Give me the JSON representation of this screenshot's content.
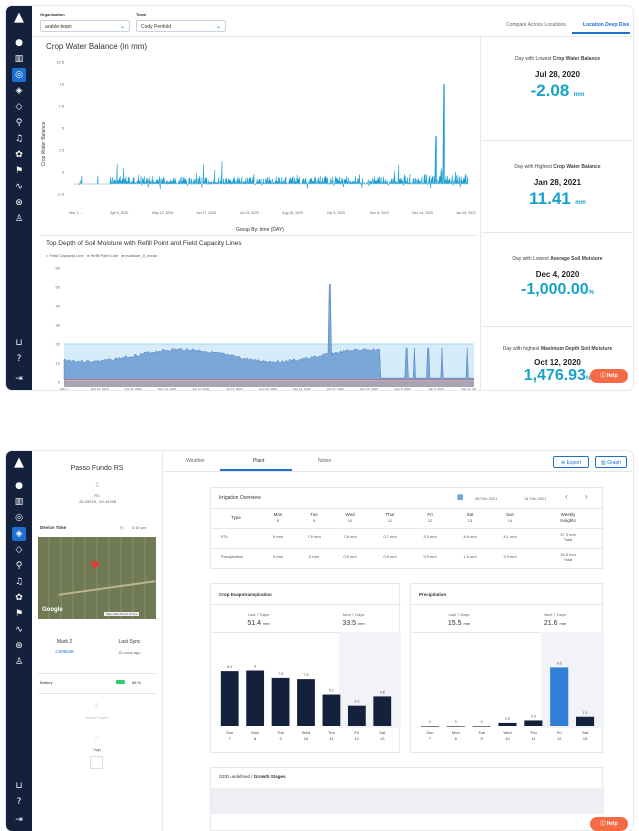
{
  "top": {
    "filters": {
      "organisation_label": "Organisation",
      "organisation_value": "arable-team",
      "team_label": "Team",
      "team_value": "Cody Penfold"
    },
    "tabs": [
      "Compare Across Locations",
      "Location Deep Dive"
    ],
    "chart1": {
      "title": "Crop Water Balance (in mm)",
      "ylabel": "Crop Water Balance",
      "xlabel": "Group By: time (DAY)",
      "ticks_y": [
        "12.5",
        "10",
        "7.5",
        "5",
        "2.5",
        "0",
        "-2.5"
      ],
      "ticks_x": [
        "Mar 1, ...",
        "Apr 6, 2020",
        "May 12, 2020",
        "Jun 17, 2020",
        "Jul 23, 2020",
        "Aug 28, 2020",
        "Oct 3, 2020",
        "Nov 8, 2020",
        "Dec 14, 2020",
        "Jan 19, 2021"
      ]
    },
    "chart2": {
      "title": "Top Depth of Soil Moisture with Refill Point and Field Capacity Lines",
      "legend": [
        "Field Capacity Line",
        "Refill Point Line",
        "moisture_0_mean"
      ],
      "legend_colors": [
        "#8fd3f0",
        "#e24a33",
        "#1f4e9c"
      ],
      "ticks_y": [
        "60",
        "50",
        "40",
        "30",
        "20",
        "10",
        "0"
      ],
      "ticks_x": [
        "Mar 1, ...",
        "Mar 19, 2020",
        "Apr 26, 2020",
        "May 14, 2020",
        "Jun 11, 2020",
        "Jul 13, 2020",
        "Aug 10, 2020",
        "Sep 12, 2020",
        "Oct 17, 2020",
        "Nov 13, 2020",
        "Dec 5, 2020",
        "Jan 5, 2021",
        "Feb 12, 2021"
      ]
    },
    "kpis": [
      {
        "title_pre": "Day with Lowest ",
        "title_bold": "Crop Water Balance",
        "date": "Jul 28, 2020",
        "value": "-2.08",
        "unit": "mm"
      },
      {
        "title_pre": "Day with Highest ",
        "title_bold": "Crop Water Balance",
        "date": "Jan 28, 2021",
        "value": "11.41",
        "unit": "mm"
      },
      {
        "title_pre": "Day with Lowest ",
        "title_bold": "Average Soil Moisture",
        "date": "Dec 4, 2020",
        "value": "-1,000.00",
        "unit": "%"
      },
      {
        "title_pre": "Day with highest ",
        "title_bold": "Maximum Depth Soil Moisture",
        "date": "Oct 12, 2020",
        "value": "1,476.93",
        "unit": "%"
      }
    ],
    "help": "Help"
  },
  "bottom": {
    "device": {
      "name": "Passo Fundo RS",
      "location_code": "RS",
      "coords": "-28.25978, -52.44298",
      "device_time_label": "Device Time",
      "device_time": "4:16 pm",
      "map_logo": "Google",
      "map_terms": "Map Data   Terms of Use",
      "model_label": "Mark 2",
      "model_value": "C005048",
      "sync_label": "Last Sync",
      "sync_value": "51 mins ago",
      "battery_label": "Battery",
      "battery_value": "86 %",
      "water_label": "Water Found",
      "tags_label": "Tags"
    },
    "tabs": [
      "Weather",
      "Plant",
      "Notes"
    ],
    "actions": {
      "export": "Export",
      "graph": "Graph"
    },
    "irrigation": {
      "title": "Irrigation Overview",
      "range_start": "08 Feb 2021",
      "range_end": "14 Feb 2021",
      "type_header": "Type",
      "days": [
        [
          "Mon",
          "8"
        ],
        [
          "Tue",
          "9"
        ],
        [
          "Wed",
          "10"
        ],
        [
          "Thur",
          "11"
        ],
        [
          "Fri",
          "12"
        ],
        [
          "Sat",
          "13"
        ],
        [
          "Sun",
          "14"
        ]
      ],
      "weekly_header": [
        "Weekly",
        "Insights"
      ],
      "rows": [
        {
          "type": "ETc",
          "values": [
            "9 mm",
            "7.8 mm",
            "7.6 mm",
            "0.7 mm",
            "3.3 mm",
            "4.8 mm",
            "4.1 mm"
          ],
          "total": "37.3 mm",
          "total_label": "Total"
        },
        {
          "type": "Precipitation",
          "values": [
            "0 mm",
            "0 mm",
            "0.5 mm",
            "0.9 mm",
            "9.5 mm",
            "1.5 mm",
            "3.9 mm"
          ],
          "total": "16.3 mm",
          "total_label": "Total"
        }
      ]
    },
    "crop_et": {
      "title": "Crop Evapotranspiration",
      "last_label": "Last 7 Days",
      "last_value": "51.4",
      "last_unit": "mm",
      "next_label": "Next 7 Days",
      "next_value": "33.5",
      "next_unit": "mm"
    },
    "precip": {
      "title": "Precipitation",
      "last_label": "Last 7 Days",
      "last_value": "15.5",
      "last_unit": "mm",
      "next_label": "Next 7 Days",
      "next_value": "21.6",
      "next_unit": "mm"
    },
    "gdd": {
      "title_pre": "GDD undefined / ",
      "title_bold": "Growth Stages"
    },
    "help": "Help"
  },
  "chart_data": [
    {
      "type": "bar",
      "title": "Crop Evapotranspiration",
      "categories": [
        "Sun 7",
        "Mon 8",
        "Tue 9",
        "Wed 10",
        "Thu 11",
        "Fri 12",
        "Sat 13"
      ],
      "values": [
        8.9,
        9,
        7.8,
        7.6,
        5.1,
        3.3,
        4.8
      ],
      "ylim": [
        0,
        12
      ],
      "colors": [
        "#14213d"
      ]
    },
    {
      "type": "bar",
      "title": "Precipitation",
      "categories": [
        "Sun 7",
        "Mon 8",
        "Tue 9",
        "Wed 10",
        "Thu 11",
        "Fri 12",
        "Sat 13"
      ],
      "values": [
        0,
        0,
        0,
        0.5,
        0.9,
        9.5,
        1.5
      ],
      "ylim": [
        0,
        12
      ],
      "colors": [
        "#14213d",
        "#2f7fd6"
      ]
    }
  ]
}
